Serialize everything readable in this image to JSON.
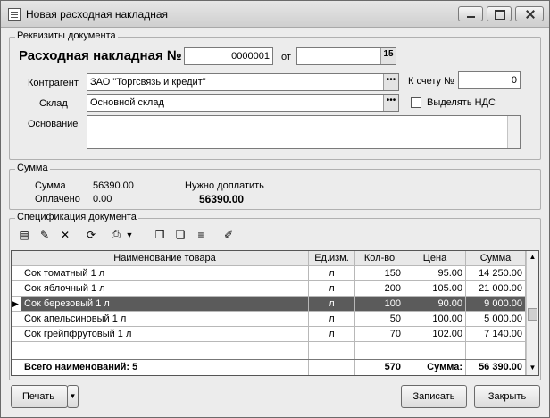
{
  "window": {
    "title": "Новая расходная накладная"
  },
  "requisites": {
    "legend": "Реквизиты документа",
    "doc_label": "Расходная накладная №",
    "doc_number": "0000001",
    "from_label": "от",
    "date_value": "",
    "counterparty_label": "Контрагент",
    "counterparty_value": "ЗАО \"Торгсвязь и кредит\"",
    "account_label": "К счету №",
    "account_value": "0",
    "warehouse_label": "Склад",
    "warehouse_value": "Основной склад",
    "vat_label": "Выделять НДС",
    "basis_label": "Основание",
    "basis_value": ""
  },
  "sum": {
    "legend": "Сумма",
    "sum_label": "Сумма",
    "sum_value": "56390.00",
    "paid_label": "Оплачено",
    "paid_value": "0.00",
    "due_label": "Нужно доплатить",
    "due_value": "56390.00"
  },
  "spec": {
    "legend": "Спецификация документа",
    "columns": [
      "Наименование товара",
      "Ед.изм.",
      "Кол-во",
      "Цена",
      "Сумма"
    ],
    "rows": [
      {
        "name": "Сок томатный 1 л",
        "unit": "л",
        "qty": "150",
        "price": "95.00",
        "sum": "14 250.00"
      },
      {
        "name": "Сок яблочный 1 л",
        "unit": "л",
        "qty": "200",
        "price": "105.00",
        "sum": "21 000.00"
      },
      {
        "name": "Сок березовый 1 л",
        "unit": "л",
        "qty": "100",
        "price": "90.00",
        "sum": "9 000.00"
      },
      {
        "name": "Сок апельсиновый 1 л",
        "unit": "л",
        "qty": "50",
        "price": "100.00",
        "sum": "5 000.00"
      },
      {
        "name": "Сок грейпфрутовый 1 л",
        "unit": "л",
        "qty": "70",
        "price": "102.00",
        "sum": "7 140.00"
      }
    ],
    "footer": {
      "total_label": "Всего наименований: 5",
      "qty_total": "570",
      "sum_label": "Сумма:",
      "sum_total": "56 390.00"
    }
  },
  "buttons": {
    "print": "Печать",
    "save": "Записать",
    "close": "Закрыть"
  }
}
